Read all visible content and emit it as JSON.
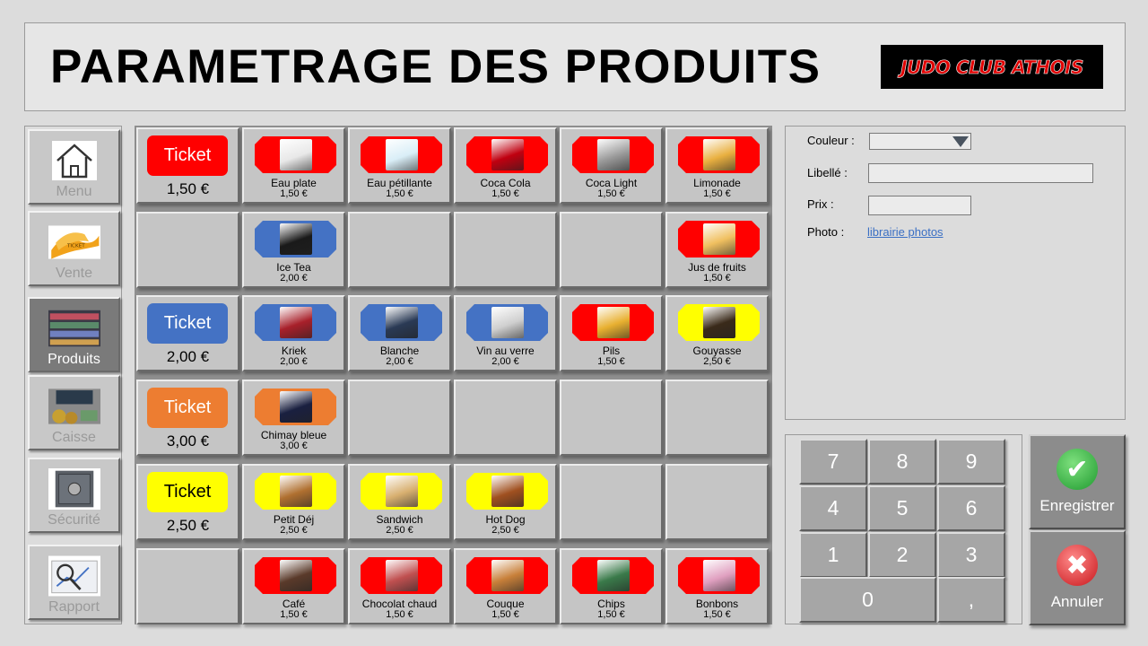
{
  "header": {
    "title": "PARAMETRAGE DES PRODUITS",
    "logo_text": "JUDO CLUB ATHOIS"
  },
  "nav": [
    {
      "label": "Menu",
      "icon": "home-icon",
      "active": false
    },
    {
      "label": "Vente",
      "icon": "tickets-icon",
      "active": false
    },
    {
      "label": "Produits",
      "icon": "shelves-icon",
      "active": true
    },
    {
      "label": "Caisse",
      "icon": "cash-register-icon",
      "active": false
    },
    {
      "label": "Sécurité",
      "icon": "safe-icon",
      "active": false
    },
    {
      "label": "Rapport",
      "icon": "report-icon",
      "active": false
    }
  ],
  "colors": {
    "red": "#ff0000",
    "blue": "#4472c4",
    "orange": "#ed7d31",
    "yellow": "#ffff00"
  },
  "grid": [
    [
      {
        "ticket": true,
        "label": "Ticket",
        "price": "1,50 €",
        "color": "red"
      },
      {
        "name": "Eau plate",
        "price": "1,50 €",
        "color": "red",
        "thumb": "#e8e8e8"
      },
      {
        "name": "Eau pétillante",
        "price": "1,50 €",
        "color": "red",
        "thumb": "#d9eef7"
      },
      {
        "name": "Coca Cola",
        "price": "1,50 €",
        "color": "red",
        "thumb": "#c00010"
      },
      {
        "name": "Coca Light",
        "price": "1,50 €",
        "color": "red",
        "thumb": "#9a9a9a"
      },
      {
        "name": "Limonade",
        "price": "1,50 €",
        "color": "red",
        "thumb": "#e9b040"
      }
    ],
    [
      {},
      {
        "name": "Ice Tea",
        "price": "2,00 €",
        "color": "blue",
        "thumb": "#1a1a1a"
      },
      {},
      {},
      {},
      {
        "name": "Jus de fruits",
        "price": "1,50 €",
        "color": "red",
        "thumb": "#f0c060"
      }
    ],
    [
      {
        "ticket": true,
        "label": "Ticket",
        "price": "2,00 €",
        "color": "blue"
      },
      {
        "name": "Kriek",
        "price": "2,00 €",
        "color": "blue",
        "thumb": "#a8202a"
      },
      {
        "name": "Blanche",
        "price": "2,00 €",
        "color": "blue",
        "thumb": "#2a3a55"
      },
      {
        "name": "Vin au verre",
        "price": "2,00 €",
        "color": "blue",
        "thumb": "#cfcfcf"
      },
      {
        "name": "Pils",
        "price": "1,50 €",
        "color": "red",
        "thumb": "#e8b030"
      },
      {
        "name": "Gouyasse",
        "price": "2,50 €",
        "color": "yellow",
        "thumb": "#3a2a1a"
      }
    ],
    [
      {
        "ticket": true,
        "label": "Ticket",
        "price": "3,00 €",
        "color": "orange"
      },
      {
        "name": "Chimay bleue",
        "price": "3,00 €",
        "color": "orange",
        "thumb": "#1a2040"
      },
      {},
      {},
      {},
      {}
    ],
    [
      {
        "ticket": true,
        "label": "Ticket",
        "price": "2,50 €",
        "color": "yellow"
      },
      {
        "name": "Petit Déj",
        "price": "2,50 €",
        "color": "yellow",
        "thumb": "#b07030"
      },
      {
        "name": "Sandwich",
        "price": "2,50 €",
        "color": "yellow",
        "thumb": "#d8b070"
      },
      {
        "name": "Hot Dog",
        "price": "2,50 €",
        "color": "yellow",
        "thumb": "#a05020"
      },
      {},
      {}
    ],
    [
      {},
      {
        "name": "Café",
        "price": "1,50 €",
        "color": "red",
        "thumb": "#5a3a2a"
      },
      {
        "name": "Chocolat chaud",
        "price": "1,50 €",
        "color": "red",
        "thumb": "#c05050"
      },
      {
        "name": "Couque",
        "price": "1,50 €",
        "color": "red",
        "thumb": "#c8803a"
      },
      {
        "name": "Chips",
        "price": "1,50 €",
        "color": "red",
        "thumb": "#3a7a4a"
      },
      {
        "name": "Bonbons",
        "price": "1,50 €",
        "color": "red",
        "thumb": "#e0a0c0"
      }
    ]
  ],
  "form": {
    "couleur_label": "Couleur  :",
    "libelle_label": "Libellé  :",
    "prix_label": "Prix  :",
    "photo_label": "Photo :",
    "photo_link": "librairie  photos",
    "couleur_value": "",
    "libelle_value": "",
    "prix_value": ""
  },
  "keypad": [
    "7",
    "8",
    "9",
    "4",
    "5",
    "6",
    "1",
    "2",
    "3",
    "0",
    ","
  ],
  "actions": {
    "save": "Enregistrer",
    "cancel": "Annuler"
  }
}
